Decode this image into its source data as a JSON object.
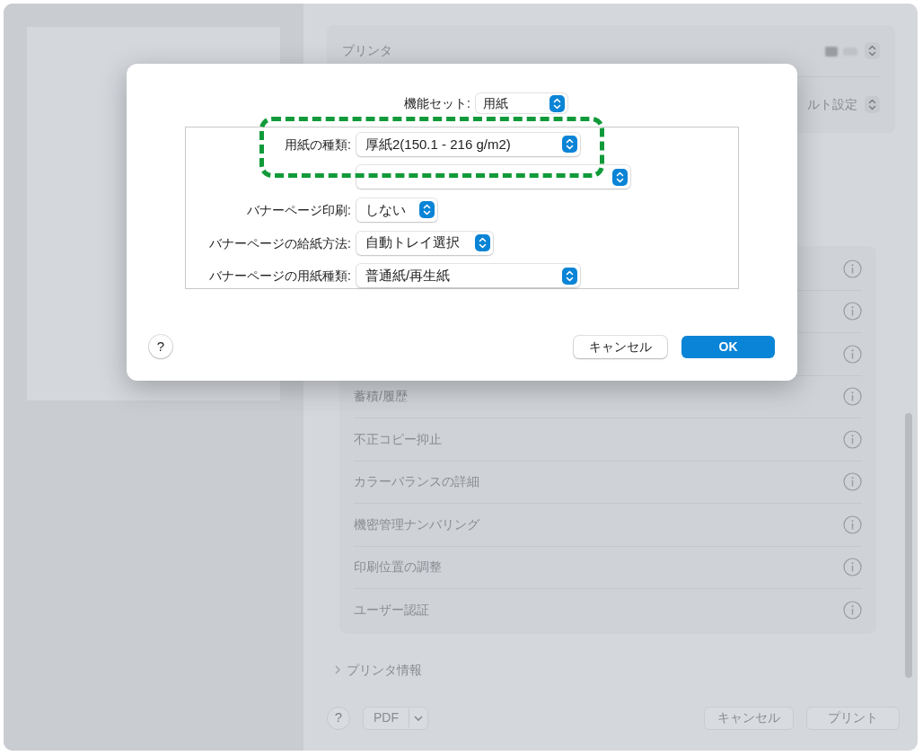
{
  "printer_panel": {
    "label": "プリンタ",
    "preset_value": "ルト設定"
  },
  "option_rows": [
    {
      "label": null
    },
    {
      "label": null
    },
    {
      "label": null
    },
    {
      "label": "蓄積/履歴"
    },
    {
      "label": "不正コピー抑止"
    },
    {
      "label": "カラーバランスの詳細"
    },
    {
      "label": "機密管理ナンバリング"
    },
    {
      "label": "印刷位置の調整"
    },
    {
      "label": "ユーザー認証"
    }
  ],
  "printer_info": {
    "label": "プリンタ情報",
    "expanded": false
  },
  "footer": {
    "help": "?",
    "pdf": "PDF",
    "cancel": "キャンセル",
    "print": "プリント"
  },
  "dialog": {
    "feature_set": {
      "label": "機能セット:",
      "value": "用紙"
    },
    "settings": [
      {
        "label": "用紙の種類:",
        "value": "厚紙2(150.1 - 216 g/m2)",
        "highlighted": true
      },
      {
        "highlighted": false
      },
      {
        "label": "バナーページ印刷:",
        "value": "しない",
        "highlighted": false
      },
      {
        "label": "バナーページの給紙方法:",
        "value": "自動トレイ選択",
        "highlighted": false
      },
      {
        "label": "バナーページの用紙種類:",
        "value": "普通紙/再生紙",
        "highlighted": false
      }
    ],
    "help": "?",
    "cancel": "キャンセル",
    "ok": "OK"
  }
}
